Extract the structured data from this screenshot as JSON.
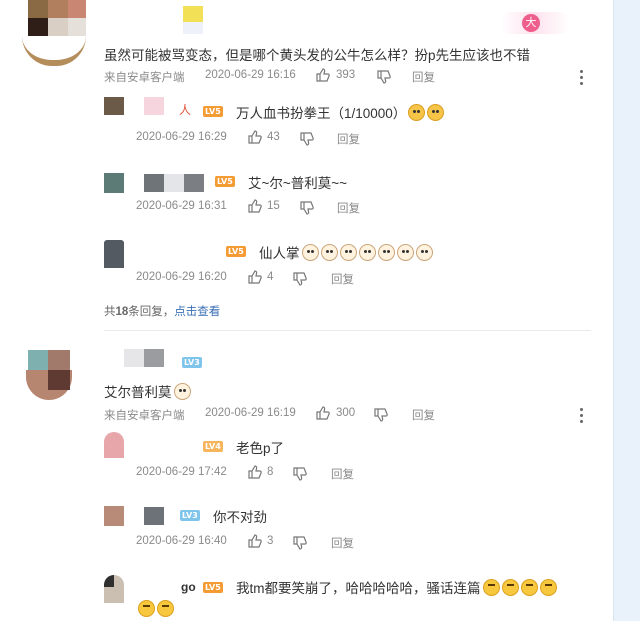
{
  "comments": [
    {
      "text": "虽然可能被骂变态，但是哪个黄头发的公牛怎么样？扮p先生应该也不错",
      "source": "来自安卓客户端",
      "time": "2020-06-29 16:16",
      "likes": "393",
      "reply_label": "回复",
      "replies": [
        {
          "name_suffix": "人",
          "level": "LV5",
          "text": "万人血书扮拳王（1/10000）",
          "time": "2020-06-29 16:29",
          "likes": "43",
          "reply_label": "回复",
          "emojis": [
            "cat",
            "cat"
          ]
        },
        {
          "level": "LV5",
          "text": "艾~尔~普利莫~~",
          "time": "2020-06-29 16:31",
          "likes": "15",
          "reply_label": "回复"
        },
        {
          "level": "LV5",
          "text": "仙人掌",
          "time": "2020-06-29 16:20",
          "likes": "4",
          "reply_label": "回复",
          "emojis": [
            "dog",
            "dog",
            "dog",
            "dog",
            "dog",
            "dog",
            "dog"
          ]
        }
      ],
      "summary_prefix": "共",
      "summary_count": "18",
      "summary_suffix": "条回复，",
      "summary_link": "点击查看"
    },
    {
      "level": "LV3",
      "text": "艾尔普利莫",
      "source": "来自安卓客户端",
      "time": "2020-06-29 16:19",
      "likes": "300",
      "reply_label": "回复",
      "emojis": [
        "dog"
      ],
      "replies": [
        {
          "level": "LV4",
          "text": "老色p了",
          "time": "2020-06-29 17:42",
          "likes": "8",
          "reply_label": "回复"
        },
        {
          "level": "LV3",
          "text": "你不对劲",
          "time": "2020-06-29 16:40",
          "likes": "3",
          "reply_label": "回复"
        },
        {
          "name_suffix": "go",
          "level": "LV5",
          "text": "我tm都要笑崩了，哈哈哈哈哈，骚话连篇",
          "emojis": [
            "laugh",
            "laugh",
            "laugh",
            "laugh"
          ],
          "emojis_line2": [
            "laugh",
            "laugh"
          ]
        }
      ]
    }
  ],
  "badge_text": "大",
  "icons": {
    "like": "thumbs-up-icon",
    "dislike": "thumbs-down-icon",
    "more": "more-vertical-icon"
  },
  "colors": {
    "link": "#3b6fb6",
    "level_badge": "#f59b34",
    "sidebar": "#e9f1fb"
  }
}
